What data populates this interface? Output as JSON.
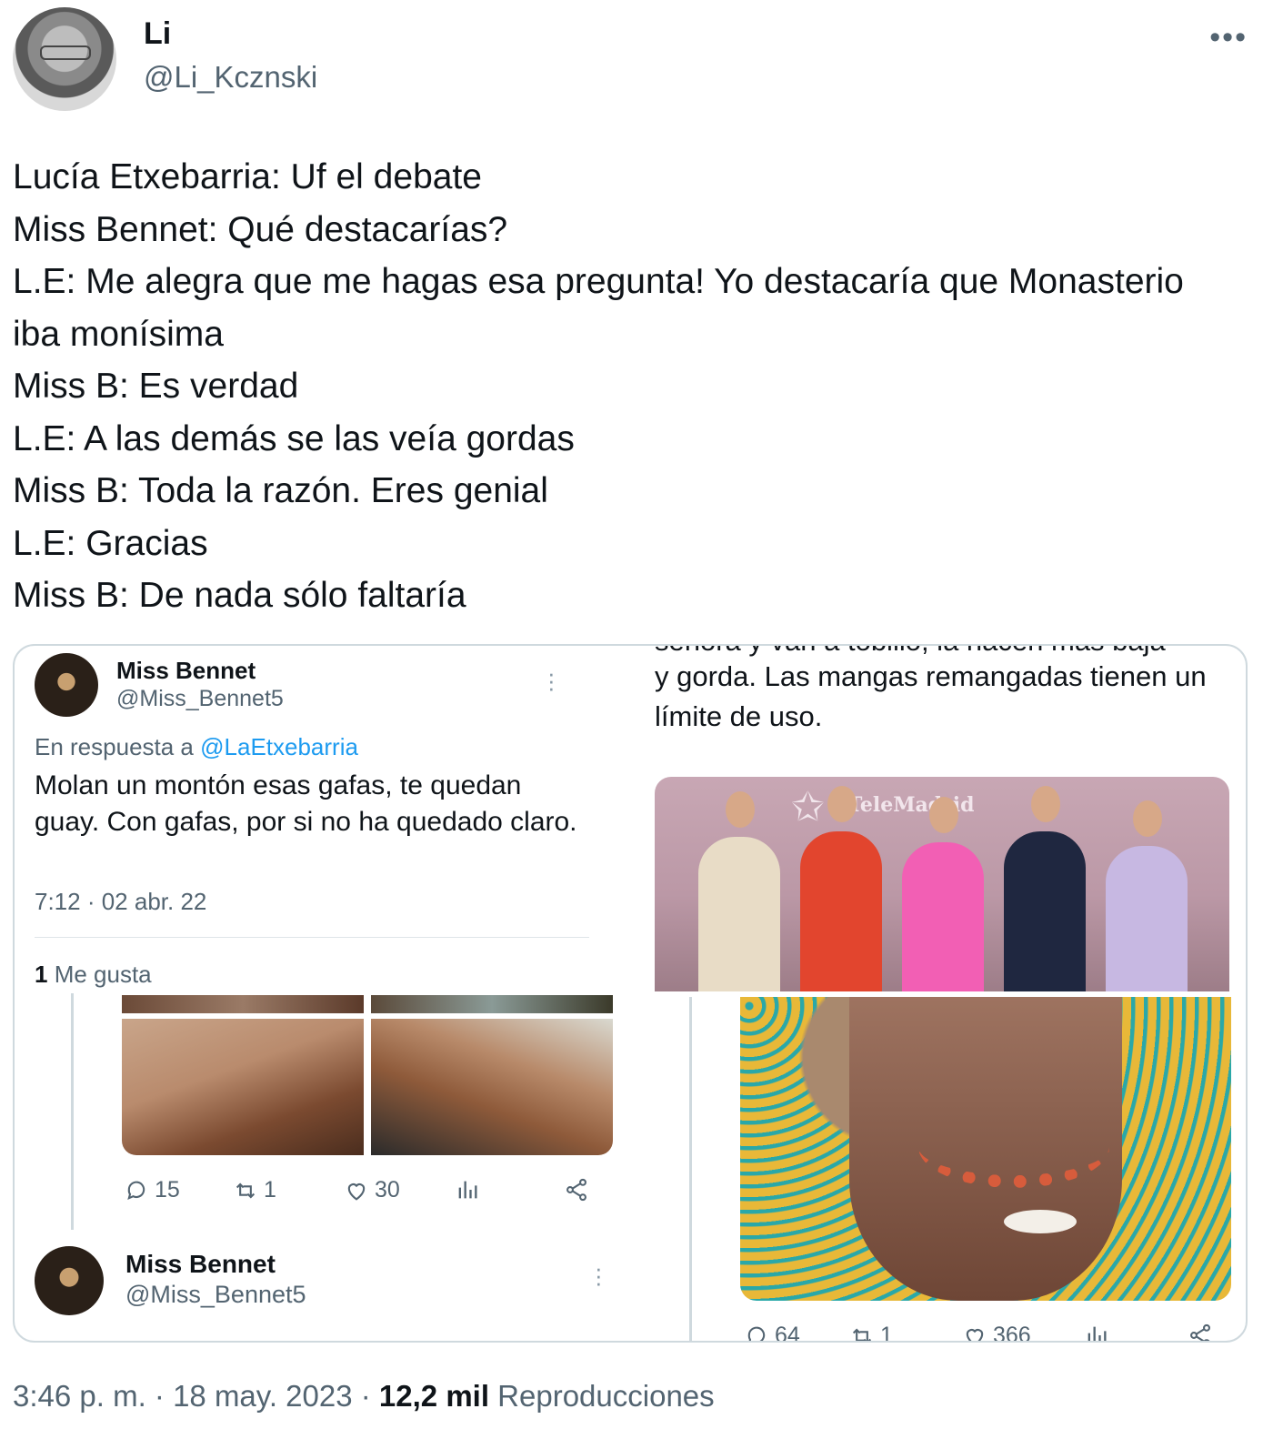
{
  "author": {
    "name": "Li",
    "handle": "@Li_Kcznski"
  },
  "more_icon": "more-horizontal-icon",
  "tweet_lines": [
    "Lucía Etxebarria: Uf el debate",
    "Miss Bennet: Qué destacarías?",
    "L.E: Me alegra que me hagas esa pregunta! Yo destacaría que Monasterio",
    "iba monísima",
    "Miss B: Es verdad",
    "L.E: A las demás se las veía gordas",
    "Miss B: Toda la razón. Eres genial",
    "L.E: Gracias",
    "Miss B: De nada sólo faltaría"
  ],
  "embedded": {
    "left": {
      "top_tweet": {
        "name": "Miss Bennet",
        "handle": "@Miss_Bennet5",
        "reply_prefix": "En respuesta a ",
        "reply_mention": "@LaEtxebarria",
        "text": "Molan un montón esas gafas, te quedan guay. Con gafas, por si no ha quedado claro.",
        "time": "7:12 · 02 abr. 22",
        "likes_count": "1",
        "likes_label": " Me gusta"
      },
      "actions": {
        "replies": "15",
        "retweets": "1",
        "likes": "30"
      },
      "second_tweet": {
        "name": "Miss Bennet",
        "handle": "@Miss_Bennet5"
      }
    },
    "right": {
      "cut_line": "señora y van a tobillo, la hacen más baja",
      "text": "y gorda. Las mangas remangadas tienen un límite de uso.",
      "tv_logo": "TeleMadrid",
      "actions": {
        "replies": "64",
        "retweets": "1",
        "likes": "366"
      }
    }
  },
  "footer": {
    "time": "3:46 p. m. · 18 may. 2023 · ",
    "views_count": "12,2 mil",
    "views_label": " Reproducciones"
  }
}
